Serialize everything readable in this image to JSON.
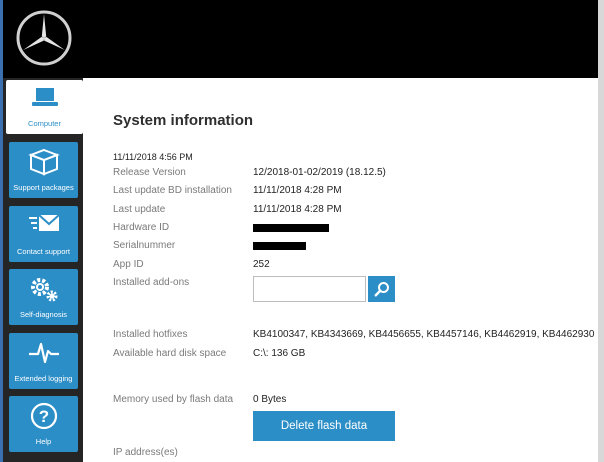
{
  "app": {
    "logo_icon": "mercedes-star-logo",
    "accent_color": "#2c8ec7"
  },
  "sidebar": {
    "items": [
      {
        "label": "Computer",
        "icon": "laptop-icon",
        "active": true
      },
      {
        "label": "Support packages",
        "icon": "package-box-icon",
        "active": false
      },
      {
        "label": "Contact support",
        "icon": "envelope-icon",
        "active": false
      },
      {
        "label": "Self-diagnosis",
        "icon": "gears-icon",
        "active": false
      },
      {
        "label": "Extended logging",
        "icon": "pulse-icon",
        "active": false
      },
      {
        "label": "Help",
        "icon": "question-icon",
        "active": false
      }
    ]
  },
  "main": {
    "title": "System information",
    "timestamp": "11/11/2018 4:56 PM",
    "fields": {
      "release_version": {
        "label": "Release Version",
        "value": "12/2018-01-02/2019 (18.12.5)"
      },
      "last_update_bd": {
        "label": "Last update BD installation",
        "value": "11/11/2018 4:28 PM"
      },
      "last_update": {
        "label": "Last update",
        "value": "11/11/2018 4:28 PM"
      },
      "hardware_id": {
        "label": "Hardware ID",
        "value": ""
      },
      "serialnummer": {
        "label": "Serialnummer",
        "value": ""
      },
      "app_id": {
        "label": "App ID",
        "value": "252"
      },
      "installed_addons": {
        "label": "Installed add-ons",
        "value": "",
        "placeholder": ""
      },
      "installed_hotfixes": {
        "label": "Installed hotfixes",
        "value": "KB4100347, KB4343669, KB4456655, KB4457146, KB4462919, KB4462930"
      },
      "hard_disk_space": {
        "label": "Available hard disk space",
        "value": "C:\\: 136 GB"
      },
      "flash_memory": {
        "label": "Memory used by flash data",
        "value": "0 Bytes"
      },
      "ip_addresses": {
        "label": "IP address(es)"
      }
    },
    "delete_button": "Delete flash data"
  }
}
